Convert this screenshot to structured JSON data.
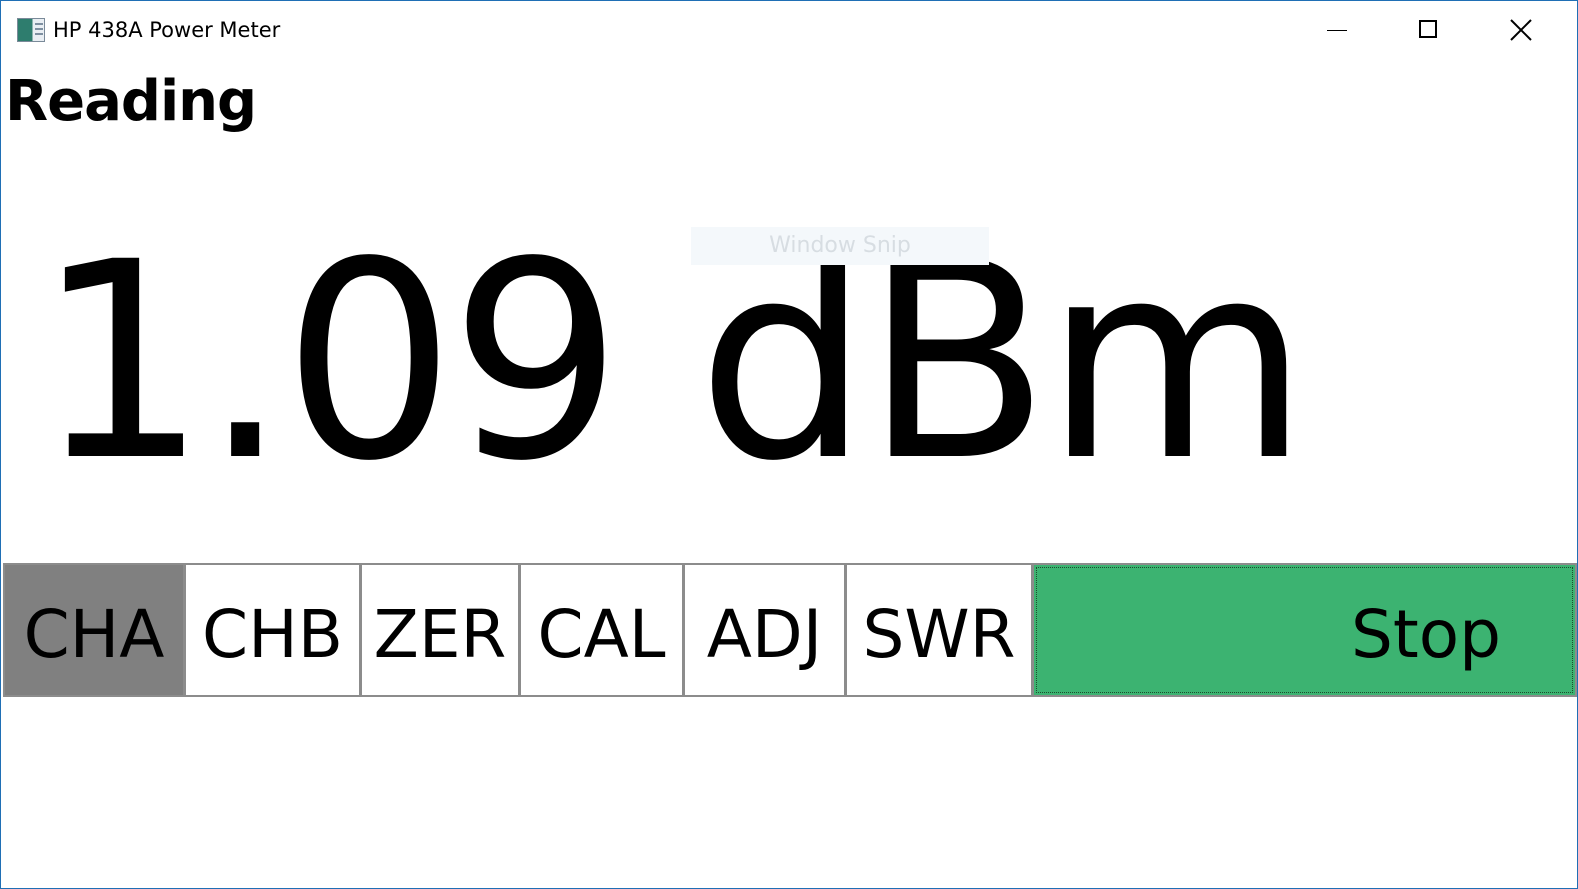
{
  "window": {
    "title": "HP 438A Power Meter",
    "icon": "app-icon",
    "controls": [
      "minimize-icon",
      "maximize-icon",
      "close-icon"
    ]
  },
  "heading": "Reading",
  "reading": {
    "value": "1.09 dBm"
  },
  "overlay": {
    "label": "Window Snip"
  },
  "buttons": [
    {
      "label": "CHA",
      "state": "active"
    },
    {
      "label": "CHB",
      "state": "normal"
    },
    {
      "label": "ZER",
      "state": "normal"
    },
    {
      "label": "CAL",
      "state": "normal"
    },
    {
      "label": "ADJ",
      "state": "normal"
    },
    {
      "label": "SWR",
      "state": "normal"
    },
    {
      "label": "Stop",
      "state": "focused"
    }
  ],
  "colors": {
    "active_button": "#808080",
    "stop_button": "#3cb371",
    "window_border": "#1f6fb5"
  }
}
